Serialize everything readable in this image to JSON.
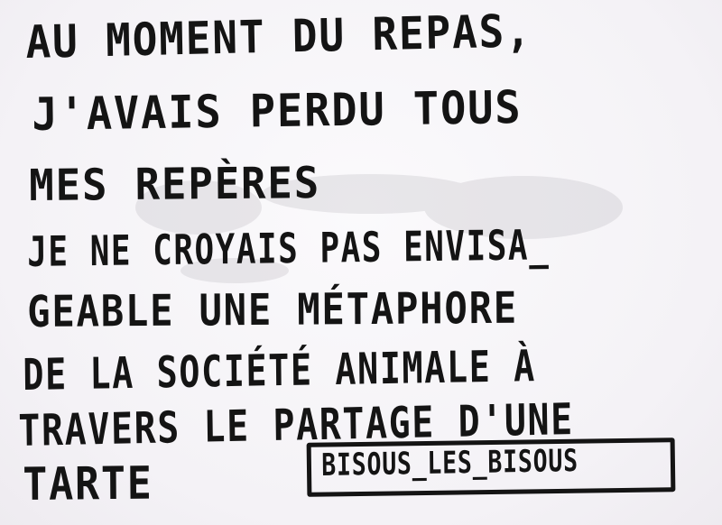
{
  "note": {
    "lines": [
      "AU MOMENT DU REPAS,",
      "J'AVAIS PERDU TOUS",
      "MES REPÈRES",
      "JE NE CROYAIS PAS ENVISA_",
      "GEABLE UNE MÉTAPHORE",
      "DE LA SOCIÉTÉ ANIMALE À",
      "TRAVERS LE PARTAGE D'UNE",
      "TARTE"
    ],
    "signature": "BISOUS_LES_BISOUS"
  },
  "colors": {
    "paper": "#f7f5f8",
    "ink": "#141414",
    "stamp": "#8a8790"
  }
}
